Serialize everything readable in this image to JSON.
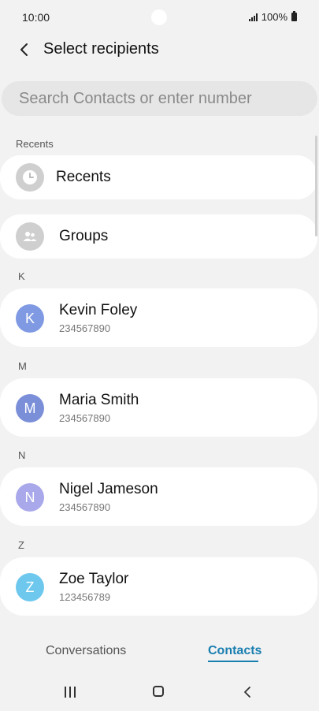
{
  "status_bar": {
    "time": "10:00",
    "signal": ".ıll",
    "battery": "100%"
  },
  "header": {
    "title": "Select recipients"
  },
  "search": {
    "placeholder": "Search Contacts or enter number"
  },
  "recents_section": {
    "label": "Recents",
    "item_label": "Recents"
  },
  "groups": {
    "label": "Groups"
  },
  "contacts": [
    {
      "section": "K",
      "initial": "K",
      "name": "Kevin Foley",
      "number": "234567890",
      "color": "#7f9ae3"
    },
    {
      "section": "M",
      "initial": "M",
      "name": "Maria Smith",
      "number": "234567890",
      "color": "#7b8fd9"
    },
    {
      "section": "N",
      "initial": "N",
      "name": "Nigel Jameson",
      "number": "234567890",
      "color": "#a9a8ea"
    },
    {
      "section": "Z",
      "initial": "Z",
      "name": "Zoe Taylor",
      "number": "123456789",
      "color": "#6ec8ee"
    }
  ],
  "tabs": {
    "conversations": "Conversations",
    "contacts": "Contacts",
    "active": "contacts"
  }
}
